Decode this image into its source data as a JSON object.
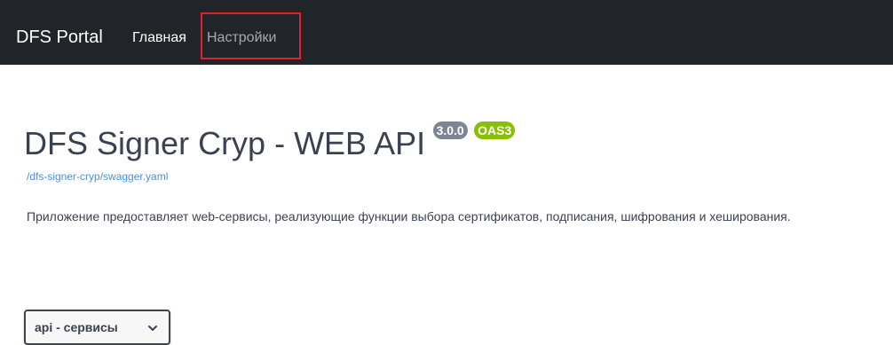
{
  "navbar": {
    "brand": "DFS Portal",
    "links": [
      {
        "label": "Главная"
      },
      {
        "label": "Настройки"
      }
    ]
  },
  "info": {
    "title": "DFS Signer Cryp - WEB API",
    "version_badge": "3.0.0",
    "oas_badge": "OAS3",
    "spec_url": "/dfs-signer-cryp/swagger.yaml",
    "description": "Приложение предоставляет web-сервисы, реализующие функции выбора сертификатов, подписания, шифрования и хеширования."
  },
  "servers": {
    "selected": "api - сервисы",
    "icon": "chevron-down-icon"
  },
  "colors": {
    "navbar_bg": "#212529",
    "highlight": "#e0212a",
    "version_badge": "#7d8492",
    "oas_badge": "#89bf04",
    "link": "#4990e2"
  }
}
